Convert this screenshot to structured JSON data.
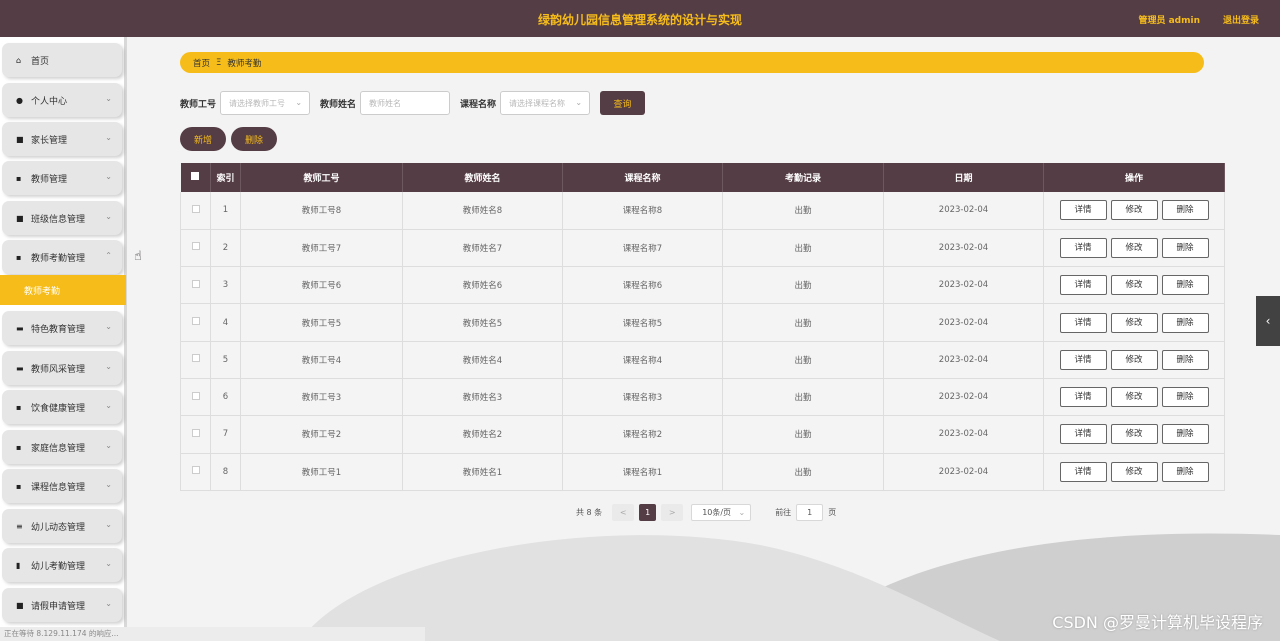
{
  "header": {
    "title": "绿韵幼儿园信息管理系统的设计与实现",
    "user": "管理员 admin",
    "logout": "退出登录"
  },
  "sidebar": {
    "items": [
      {
        "label": "首页",
        "icon": "home-icon",
        "glyph": "⌂",
        "chev": ""
      },
      {
        "label": "个人中心",
        "icon": "user-icon",
        "glyph": "●",
        "chev": "⌄"
      },
      {
        "label": "家长管理",
        "icon": "clipboard-icon",
        "glyph": "■",
        "chev": "⌄"
      },
      {
        "label": "教师管理",
        "icon": "grid-icon",
        "glyph": "▪",
        "chev": "⌄"
      },
      {
        "label": "班级信息管理",
        "icon": "clipboard-icon",
        "glyph": "■",
        "chev": "⌄"
      },
      {
        "label": "教师考勤管理",
        "icon": "grid-icon",
        "glyph": "▪",
        "chev": "⌃"
      },
      {
        "label": "特色教育管理",
        "icon": "chat-icon",
        "glyph": "▬",
        "chev": "⌄"
      },
      {
        "label": "教师风采管理",
        "icon": "briefcase-icon",
        "glyph": "▬",
        "chev": "⌄"
      },
      {
        "label": "饮食健康管理",
        "icon": "grid-icon",
        "glyph": "▪",
        "chev": "⌄"
      },
      {
        "label": "家庭信息管理",
        "icon": "grid-icon",
        "glyph": "▪",
        "chev": "⌄"
      },
      {
        "label": "课程信息管理",
        "icon": "grid-icon",
        "glyph": "▪",
        "chev": "⌄"
      },
      {
        "label": "幼儿动态管理",
        "icon": "list-icon",
        "glyph": "≡",
        "chev": "⌄"
      },
      {
        "label": "幼儿考勤管理",
        "icon": "bar-chart-icon",
        "glyph": "▮",
        "chev": "⌄"
      },
      {
        "label": "请假申请管理",
        "icon": "check-square-icon",
        "glyph": "■",
        "chev": "⌄"
      }
    ],
    "active_sub": "教师考勤"
  },
  "status_bar": "正在等待 8.129.11.174 的响应...",
  "breadcrumb": {
    "home": "首页",
    "separator": "Ξ",
    "current": "教师考勤"
  },
  "search": {
    "teacher_id_label": "教师工号",
    "teacher_id_placeholder": "请选择教师工号",
    "teacher_name_label": "教师姓名",
    "teacher_name_placeholder": "教师姓名",
    "course_label": "课程名称",
    "course_placeholder": "请选择课程名称",
    "query_button": "查询"
  },
  "actions": {
    "add": "新增",
    "delete": "删除"
  },
  "table": {
    "headers": [
      "索引",
      "教师工号",
      "教师姓名",
      "课程名称",
      "考勤记录",
      "日期",
      "操作"
    ],
    "rows": [
      {
        "index": "1",
        "teacher_id": "教师工号8",
        "teacher_name": "教师姓名8",
        "course": "课程名称8",
        "attendance": "出勤",
        "date": "2023-02-04"
      },
      {
        "index": "2",
        "teacher_id": "教师工号7",
        "teacher_name": "教师姓名7",
        "course": "课程名称7",
        "attendance": "出勤",
        "date": "2023-02-04"
      },
      {
        "index": "3",
        "teacher_id": "教师工号6",
        "teacher_name": "教师姓名6",
        "course": "课程名称6",
        "attendance": "出勤",
        "date": "2023-02-04"
      },
      {
        "index": "4",
        "teacher_id": "教师工号5",
        "teacher_name": "教师姓名5",
        "course": "课程名称5",
        "attendance": "出勤",
        "date": "2023-02-04"
      },
      {
        "index": "5",
        "teacher_id": "教师工号4",
        "teacher_name": "教师姓名4",
        "course": "课程名称4",
        "attendance": "出勤",
        "date": "2023-02-04"
      },
      {
        "index": "6",
        "teacher_id": "教师工号3",
        "teacher_name": "教师姓名3",
        "course": "课程名称3",
        "attendance": "出勤",
        "date": "2023-02-04"
      },
      {
        "index": "7",
        "teacher_id": "教师工号2",
        "teacher_name": "教师姓名2",
        "course": "课程名称2",
        "attendance": "出勤",
        "date": "2023-02-04"
      },
      {
        "index": "8",
        "teacher_id": "教师工号1",
        "teacher_name": "教师姓名1",
        "course": "课程名称1",
        "attendance": "出勤",
        "date": "2023-02-04"
      }
    ],
    "row_actions": {
      "detail": "详情",
      "edit": "修改",
      "delete": "删除"
    }
  },
  "pagination": {
    "total": "共 8 条",
    "prev": "<",
    "current_page": "1",
    "next": ">",
    "page_size": "10条/页",
    "goto_label": "前往",
    "goto_value": "1",
    "page_suffix": "页"
  },
  "watermark": "CSDN @罗曼计算机毕设程序",
  "colors": {
    "primary": "#553d45",
    "accent": "#f6bd1a",
    "background": "#f4f3f3"
  }
}
